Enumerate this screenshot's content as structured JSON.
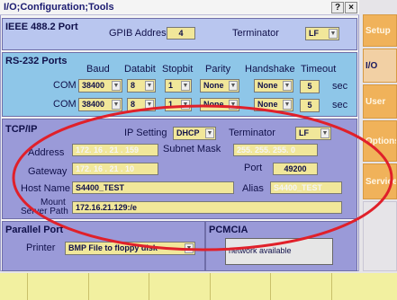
{
  "title": "I/O;Configuration;Tools",
  "titlebar": {
    "help_label": "?",
    "close_label": "×"
  },
  "ieee": {
    "heading": "IEEE 488.2 Port",
    "gpib_label": "GPIB Address",
    "gpib_value": "4",
    "terminator_label": "Terminator",
    "terminator_value": "LF"
  },
  "rs232": {
    "heading": "RS-232 Ports",
    "headers": [
      "Baud",
      "Databit",
      "Stopbit",
      "Parity",
      "Handshake",
      "Timeout"
    ],
    "rows": [
      {
        "name": "COM 1",
        "baud": "38400",
        "databit": "8",
        "stopbit": "1",
        "parity": "None",
        "handshake": "None",
        "timeout": "5",
        "unit": "sec"
      },
      {
        "name": "COM 2",
        "baud": "38400",
        "databit": "8",
        "stopbit": "1",
        "parity": "None",
        "handshake": "None",
        "timeout": "5",
        "unit": "sec"
      }
    ]
  },
  "tcp": {
    "heading": "TCP/IP",
    "ip_setting_label": "IP Setting",
    "ip_setting_value": "DHCP",
    "terminator_label": "Terminator",
    "terminator_value": "LF",
    "address_label": "Address",
    "address_value": "172. 16 . 21 . 159",
    "subnet_label": "Subnet Mask",
    "subnet_value": "255. 255. 255. 0",
    "gateway_label": "Gateway",
    "gateway_value": "172. 16 . 21 . 10",
    "port_label": "Port",
    "port_value": "49200",
    "hostname_label": "Host Name",
    "hostname_value": "S4400_TEST",
    "alias_label": "Alias",
    "alias_value": "S4400_TEST",
    "mount_label_1": "Mount",
    "mount_label_2": "Server Path",
    "mount_value": "172.16.21.129:/e"
  },
  "parallel": {
    "heading": "Parallel Port",
    "printer_label": "Printer",
    "printer_value": "BMP File to floppy disk"
  },
  "pcmcia": {
    "heading": "PCMCIA",
    "status": "network available"
  },
  "sidebar": [
    {
      "label": "Setup",
      "active": false
    },
    {
      "label": "I/O",
      "active": true
    },
    {
      "label": "User",
      "active": false
    },
    {
      "label": "Options",
      "active": false
    },
    {
      "label": "Service",
      "active": false
    }
  ],
  "colors": {
    "accent": "#f0b25a",
    "highlight_oval": "#e0202a",
    "field": "#f1e79a"
  }
}
